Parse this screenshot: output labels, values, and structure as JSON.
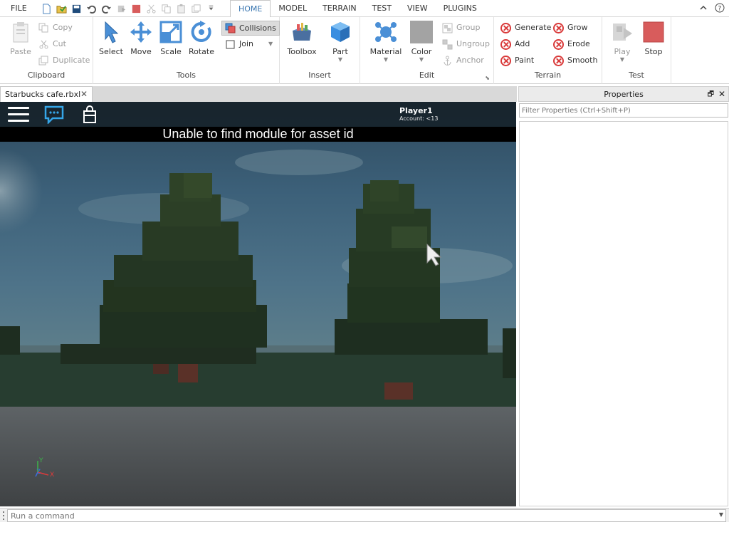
{
  "menu": {
    "file": "FILE"
  },
  "tabs": [
    "HOME",
    "MODEL",
    "TERRAIN",
    "TEST",
    "VIEW",
    "PLUGINS"
  ],
  "active_tab": "HOME",
  "ribbon": {
    "clipboard": {
      "label": "Clipboard",
      "paste": "Paste",
      "copy": "Copy",
      "cut": "Cut",
      "duplicate": "Duplicate"
    },
    "tools": {
      "label": "Tools",
      "select": "Select",
      "move": "Move",
      "scale": "Scale",
      "rotate": "Rotate",
      "collisions": "Collisions",
      "join": "Join"
    },
    "insert": {
      "label": "Insert",
      "toolbox": "Toolbox",
      "part": "Part"
    },
    "edit": {
      "label": "Edit",
      "material": "Material",
      "color": "Color",
      "group": "Group",
      "ungroup": "Ungroup",
      "anchor": "Anchor"
    },
    "terrain": {
      "label": "Terrain",
      "generate": "Generate",
      "add": "Add",
      "paint": "Paint",
      "grow": "Grow",
      "erode": "Erode",
      "smooth": "Smooth"
    },
    "test": {
      "label": "Test",
      "play": "Play",
      "stop": "Stop"
    }
  },
  "document": {
    "tab_title": "Starbucks cafe.rbxl"
  },
  "game": {
    "player_name": "Player1",
    "account": "Account: <13",
    "error_message": "Unable to find module for asset id"
  },
  "axis": {
    "y": "Y",
    "z": "Z",
    "x": "X"
  },
  "properties": {
    "title": "Properties",
    "filter_placeholder": "Filter Properties (Ctrl+Shift+P)"
  },
  "command_bar": {
    "placeholder": "Run a command"
  },
  "colors": {
    "accent": "#3875b0",
    "terrain_icon": "#d93a3a",
    "stop": "#d85c5c"
  }
}
